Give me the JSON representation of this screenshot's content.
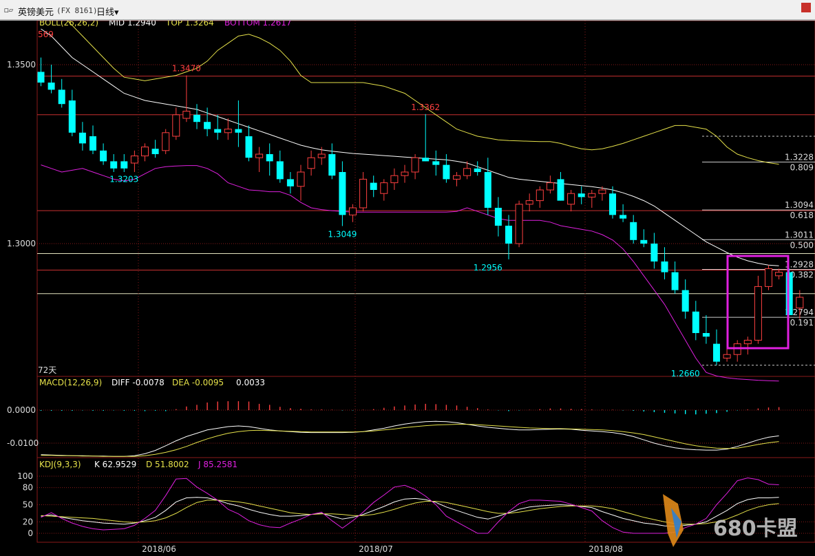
{
  "window": {
    "icon": "chart-window-icon",
    "title": "英镑美元",
    "code": "(FX 8161)",
    "period": "日线",
    "period_caret": "▾"
  },
  "colors": {
    "up": "#ff4040",
    "down": "#00ffff",
    "boll_mid": "#ffffff",
    "boll_top": "#e6e24a",
    "boll_bottom": "#e020e0",
    "diff": "#ffffff",
    "dea": "#e6e24a",
    "k": "#ffffff",
    "d": "#e6e24a",
    "j": "#e020e0",
    "grid_red": "#8b1a1a",
    "highlight": "#e020e0"
  },
  "main_panel": {
    "indicator": "BOLL(26,26,2)",
    "mid": "MID 1.2940",
    "top": "TOP 1.3264",
    "bottom": "BOTTOM 1.2617",
    "left_partial": "569",
    "bars_label": "72天",
    "price_axis": [
      {
        "label": "1.3500",
        "value": 1.35
      },
      {
        "label": "1.3000",
        "value": 1.3
      }
    ],
    "annotations": [
      {
        "text": "1.3470",
        "price": 1.347,
        "color": "#ff4040",
        "bar": 14,
        "pos": "above"
      },
      {
        "text": "1.3362",
        "price": 1.3362,
        "color": "#ff4040",
        "bar": 37,
        "pos": "above"
      },
      {
        "text": "1.3203",
        "price": 1.3203,
        "color": "#00ffff",
        "bar": 8,
        "pos": "below"
      },
      {
        "text": "1.3049",
        "price": 1.3049,
        "color": "#00ffff",
        "bar": 29,
        "pos": "below"
      },
      {
        "text": "1.2956",
        "price": 1.2956,
        "color": "#00ffff",
        "bar": 43,
        "pos": "below"
      },
      {
        "text": "1.2660",
        "price": 1.266,
        "color": "#00ffff",
        "bar": 62,
        "pos": "below"
      }
    ],
    "fib_levels": [
      {
        "price_label": "1.3228",
        "ratio_label": "0.809",
        "price": 1.3228
      },
      {
        "price_label": "1.3094",
        "ratio_label": "0.618",
        "price": 1.3094
      },
      {
        "price_label": "1.3011",
        "ratio_label": "0.500",
        "price": 1.3011
      },
      {
        "price_label": "1.2928",
        "ratio_label": "0.382",
        "price": 1.2928
      },
      {
        "price_label": "1.2794",
        "ratio_label": "0.191",
        "price": 1.2794
      }
    ]
  },
  "macd_panel": {
    "indicator": "MACD(12,26,9)",
    "diff": "DIFF -0.0078",
    "dea": "DEA -0.0095",
    "macd": "0.0033",
    "axis": [
      {
        "label": "0.0000",
        "value": 0.0
      },
      {
        "label": "-0.0100",
        "value": -0.01
      }
    ]
  },
  "kdj_panel": {
    "indicator": "KDJ(9,3,3)",
    "k": "K 62.9529",
    "d": "D 51.8002",
    "j": "J 85.2581",
    "axis": [
      "100",
      "80",
      "50",
      "20",
      "0"
    ]
  },
  "date_axis": [
    "2018/06",
    "2018/07",
    "2018/08"
  ],
  "watermark": {
    "text": "680卡盟",
    "icon": "sail-logo-icon"
  },
  "chart_data": {
    "type": "candlestick",
    "candles": [
      [
        1.348,
        1.352,
        1.344,
        1.345
      ],
      [
        1.345,
        1.35,
        1.342,
        1.343
      ],
      [
        1.343,
        1.346,
        1.338,
        1.339
      ],
      [
        1.34,
        1.343,
        1.33,
        1.331
      ],
      [
        1.331,
        1.334,
        1.326,
        1.328
      ],
      [
        1.33,
        1.333,
        1.325,
        1.326
      ],
      [
        1.326,
        1.328,
        1.322,
        1.323
      ],
      [
        1.323,
        1.325,
        1.32,
        1.321
      ],
      [
        1.323,
        1.325,
        1.32,
        1.321
      ],
      [
        1.3225,
        1.326,
        1.32,
        1.3245
      ],
      [
        1.3245,
        1.328,
        1.323,
        1.327
      ],
      [
        1.3265,
        1.329,
        1.324,
        1.325
      ],
      [
        1.326,
        1.332,
        1.325,
        1.331
      ],
      [
        1.33,
        1.338,
        1.329,
        1.336
      ],
      [
        1.335,
        1.347,
        1.334,
        1.337
      ],
      [
        1.336,
        1.339,
        1.332,
        1.334
      ],
      [
        1.334,
        1.338,
        1.33,
        1.332
      ],
      [
        1.332,
        1.336,
        1.329,
        1.331
      ],
      [
        1.331,
        1.335,
        1.329,
        1.332
      ],
      [
        1.332,
        1.34,
        1.327,
        1.331
      ],
      [
        1.33,
        1.333,
        1.323,
        1.324
      ],
      [
        1.324,
        1.327,
        1.32,
        1.325
      ],
      [
        1.325,
        1.328,
        1.319,
        1.323
      ],
      [
        1.323,
        1.326,
        1.317,
        1.318
      ],
      [
        1.318,
        1.32,
        1.314,
        1.316
      ],
      [
        1.316,
        1.322,
        1.312,
        1.32
      ],
      [
        1.321,
        1.326,
        1.319,
        1.324
      ],
      [
        1.324,
        1.327,
        1.322,
        1.325
      ],
      [
        1.325,
        1.328,
        1.318,
        1.319
      ],
      [
        1.32,
        1.323,
        1.3049,
        1.308
      ],
      [
        1.308,
        1.311,
        1.306,
        1.31
      ],
      [
        1.31,
        1.32,
        1.309,
        1.318
      ],
      [
        1.317,
        1.319,
        1.313,
        1.315
      ],
      [
        1.314,
        1.318,
        1.312,
        1.317
      ],
      [
        1.317,
        1.321,
        1.315,
        1.319
      ],
      [
        1.319,
        1.322,
        1.317,
        1.32
      ],
      [
        1.32,
        1.325,
        1.318,
        1.324
      ],
      [
        1.324,
        1.3362,
        1.323,
        1.323
      ],
      [
        1.323,
        1.326,
        1.319,
        1.322
      ],
      [
        1.322,
        1.325,
        1.317,
        1.318
      ],
      [
        1.318,
        1.32,
        1.316,
        1.319
      ],
      [
        1.319,
        1.323,
        1.318,
        1.321
      ],
      [
        1.321,
        1.323,
        1.319,
        1.32
      ],
      [
        1.32,
        1.324,
        1.308,
        1.31
      ],
      [
        1.31,
        1.313,
        1.302,
        1.305
      ],
      [
        1.305,
        1.308,
        1.2956,
        1.3
      ],
      [
        1.3,
        1.312,
        1.299,
        1.311
      ],
      [
        1.311,
        1.314,
        1.309,
        1.312
      ],
      [
        1.312,
        1.316,
        1.31,
        1.315
      ],
      [
        1.315,
        1.319,
        1.314,
        1.317
      ],
      [
        1.318,
        1.32,
        1.312,
        1.312
      ],
      [
        1.311,
        1.315,
        1.309,
        1.314
      ],
      [
        1.314,
        1.316,
        1.311,
        1.313
      ],
      [
        1.313,
        1.315,
        1.31,
        1.314
      ],
      [
        1.314,
        1.316,
        1.312,
        1.315
      ],
      [
        1.314,
        1.316,
        1.307,
        1.308
      ],
      [
        1.308,
        1.311,
        1.306,
        1.307
      ],
      [
        1.306,
        1.308,
        1.3,
        1.301
      ],
      [
        1.301,
        1.304,
        1.299,
        1.3
      ],
      [
        1.3,
        1.303,
        1.293,
        1.295
      ],
      [
        1.295,
        1.299,
        1.29,
        1.292
      ],
      [
        1.292,
        1.295,
        1.286,
        1.287
      ],
      [
        1.287,
        1.29,
        1.279,
        1.281
      ],
      [
        1.281,
        1.284,
        1.273,
        1.275
      ],
      [
        1.275,
        1.28,
        1.272,
        1.274
      ],
      [
        1.272,
        1.276,
        1.266,
        1.267
      ],
      [
        1.268,
        1.271,
        1.267,
        1.269
      ],
      [
        1.269,
        1.273,
        1.267,
        1.272
      ],
      [
        1.272,
        1.274,
        1.269,
        1.273
      ],
      [
        1.273,
        1.291,
        1.272,
        1.288
      ],
      [
        1.288,
        1.294,
        1.287,
        1.293
      ],
      [
        1.291,
        1.293,
        1.29,
        1.292
      ],
      [
        1.292,
        1.293,
        1.28,
        1.28
      ],
      [
        1.282,
        1.287,
        1.279,
        1.285
      ]
    ],
    "boll_mid": [
      1.36,
      1.358,
      1.355,
      1.352,
      1.35,
      1.348,
      1.346,
      1.344,
      1.342,
      1.341,
      1.34,
      1.3395,
      1.339,
      1.3385,
      1.338,
      1.3375,
      1.3365,
      1.3355,
      1.3345,
      1.3335,
      1.3325,
      1.3315,
      1.3305,
      1.3295,
      1.3285,
      1.3275,
      1.3268,
      1.3262,
      1.3258,
      1.3255,
      1.3252,
      1.325,
      1.3248,
      1.3246,
      1.3244,
      1.3242,
      1.324,
      1.3238,
      1.3236,
      1.3234,
      1.323,
      1.3225,
      1.3215,
      1.3205,
      1.3195,
      1.3185,
      1.318,
      1.3177,
      1.3174,
      1.3171,
      1.3168,
      1.3165,
      1.3162,
      1.3159,
      1.3155,
      1.315,
      1.3142,
      1.3132,
      1.312,
      1.3105,
      1.3085,
      1.3065,
      1.3045,
      1.3025,
      1.3005,
      1.299,
      1.2975,
      1.2962,
      1.2952,
      1.2945,
      1.294,
      1.2938
    ],
    "boll_top": [
      1.37,
      1.367,
      1.364,
      1.361,
      1.358,
      1.355,
      1.352,
      1.349,
      1.3465,
      1.346,
      1.3455,
      1.346,
      1.3465,
      1.347,
      1.348,
      1.349,
      1.351,
      1.354,
      1.356,
      1.358,
      1.3585,
      1.3575,
      1.356,
      1.354,
      1.351,
      1.347,
      1.345,
      1.345,
      1.345,
      1.345,
      1.345,
      1.345,
      1.3445,
      1.344,
      1.343,
      1.342,
      1.34,
      1.338,
      1.336,
      1.334,
      1.332,
      1.331,
      1.33,
      1.3295,
      1.329,
      1.3288,
      1.3287,
      1.3286,
      1.3285,
      1.3285,
      1.328,
      1.3272,
      1.3265,
      1.3262,
      1.3265,
      1.3272,
      1.328,
      1.329,
      1.33,
      1.331,
      1.332,
      1.333,
      1.333,
      1.3325,
      1.332,
      1.33,
      1.327,
      1.325,
      1.324,
      1.3232,
      1.3226,
      1.3222
    ],
    "boll_bottom": [
      1.322,
      1.321,
      1.32,
      1.3205,
      1.321,
      1.32,
      1.319,
      1.318,
      1.3175,
      1.318,
      1.3195,
      1.321,
      1.3215,
      1.3217,
      1.3218,
      1.3218,
      1.321,
      1.3195,
      1.317,
      1.316,
      1.315,
      1.3148,
      1.3145,
      1.3145,
      1.3135,
      1.3115,
      1.31,
      1.3095,
      1.3092,
      1.309,
      1.3088,
      1.3088,
      1.3088,
      1.3088,
      1.3088,
      1.3088,
      1.3088,
      1.3088,
      1.3088,
      1.3088,
      1.309,
      1.31,
      1.309,
      1.308,
      1.307,
      1.3065,
      1.3065,
      1.3065,
      1.3065,
      1.306,
      1.305,
      1.3045,
      1.304,
      1.3035,
      1.3025,
      1.301,
      1.2985,
      1.295,
      1.291,
      1.287,
      1.283,
      1.278,
      1.273,
      1.268,
      1.264,
      1.263,
      1.2625,
      1.2622,
      1.262,
      1.2618,
      1.2617,
      1.2616
    ],
    "macd_hist": [
      -0.0002,
      -0.0002,
      -0.0002,
      -0.0002,
      -0.0001,
      -0.0002,
      -0.0002,
      -0.0001,
      -0.0002,
      -0.0002,
      -0.0003,
      -0.0002,
      -0.0003,
      0.0003,
      0.0011,
      0.0016,
      0.0023,
      0.0026,
      0.0027,
      0.0027,
      0.0026,
      0.0019,
      0.0016,
      0.001,
      0.0006,
      0.0004,
      0.0002,
      0.0002,
      0.0001,
      -0.0001,
      -0.0001,
      0.0001,
      0.0003,
      0.0007,
      0.0011,
      0.0014,
      0.0017,
      0.0019,
      0.0018,
      0.0016,
      0.0014,
      0.001,
      0.0006,
      0.0002,
      -0.0001,
      -0.0003,
      -0.0001,
      0.0001,
      0.0003,
      0.0005,
      0.0005,
      0.0004,
      0.0003,
      0.0002,
      0.0001,
      0.0001,
      -0.0001,
      -0.0002,
      -0.0004,
      -0.0006,
      -0.0008,
      -0.001,
      -0.0012,
      -0.0013,
      -0.0011,
      -0.0009,
      -0.0005,
      -0.0001,
      0.0002,
      0.0005,
      0.0008,
      0.0009
    ],
    "macd_diff": [
      -0.0135,
      -0.0136,
      -0.0137,
      -0.0138,
      -0.0138,
      -0.0139,
      -0.0139,
      -0.014,
      -0.014,
      -0.0138,
      -0.0132,
      -0.0122,
      -0.0108,
      -0.0093,
      -0.008,
      -0.007,
      -0.006,
      -0.0055,
      -0.005,
      -0.0048,
      -0.005,
      -0.0055,
      -0.006,
      -0.0063,
      -0.0065,
      -0.0067,
      -0.0068,
      -0.0068,
      -0.0068,
      -0.0068,
      -0.0067,
      -0.0065,
      -0.006,
      -0.0055,
      -0.0048,
      -0.0042,
      -0.0038,
      -0.0035,
      -0.0034,
      -0.0035,
      -0.0038,
      -0.0043,
      -0.0048,
      -0.0052,
      -0.0055,
      -0.0058,
      -0.006,
      -0.006,
      -0.0059,
      -0.0058,
      -0.0057,
      -0.0058,
      -0.0061,
      -0.0063,
      -0.0065,
      -0.0068,
      -0.0073,
      -0.008,
      -0.009,
      -0.01,
      -0.0108,
      -0.0114,
      -0.0118,
      -0.012,
      -0.0121,
      -0.0121,
      -0.0118,
      -0.011,
      -0.01,
      -0.009,
      -0.0082,
      -0.0078
    ],
    "macd_dea": [
      -0.0137,
      -0.0137,
      -0.0138,
      -0.0138,
      -0.0139,
      -0.0139,
      -0.014,
      -0.014,
      -0.014,
      -0.014,
      -0.0138,
      -0.0134,
      -0.0128,
      -0.012,
      -0.011,
      -0.0098,
      -0.0087,
      -0.0078,
      -0.007,
      -0.0065,
      -0.0062,
      -0.0061,
      -0.0062,
      -0.0063,
      -0.0064,
      -0.0065,
      -0.0066,
      -0.0066,
      -0.0066,
      -0.0066,
      -0.0066,
      -0.0065,
      -0.0063,
      -0.006,
      -0.0057,
      -0.0053,
      -0.005,
      -0.0047,
      -0.0045,
      -0.0044,
      -0.0043,
      -0.0043,
      -0.0044,
      -0.0046,
      -0.0048,
      -0.005,
      -0.0052,
      -0.0054,
      -0.0055,
      -0.0056,
      -0.0056,
      -0.0057,
      -0.0058,
      -0.0059,
      -0.006,
      -0.0062,
      -0.0065,
      -0.0069,
      -0.0074,
      -0.0081,
      -0.0088,
      -0.0095,
      -0.0102,
      -0.0108,
      -0.0112,
      -0.0115,
      -0.0116,
      -0.0115,
      -0.011,
      -0.0104,
      -0.0099,
      -0.0095
    ],
    "kdj_k": [
      30,
      32,
      28,
      25,
      22,
      20,
      18,
      17,
      16,
      18,
      22,
      28,
      40,
      55,
      62,
      63,
      62,
      58,
      52,
      48,
      42,
      37,
      33,
      30,
      30,
      31,
      33,
      35,
      30,
      25,
      28,
      33,
      40,
      47,
      55,
      60,
      61,
      59,
      54,
      46,
      40,
      34,
      28,
      25,
      30,
      36,
      42,
      46,
      48,
      49,
      50,
      49,
      47,
      45,
      38,
      32,
      26,
      22,
      18,
      16,
      13,
      12,
      14,
      16,
      20,
      30,
      40,
      52,
      59,
      62,
      62,
      63
    ],
    "kdj_d": [
      31,
      30,
      29,
      28,
      27,
      26,
      24,
      22,
      20,
      19,
      20,
      22,
      27,
      35,
      45,
      54,
      58,
      58,
      57,
      55,
      52,
      48,
      44,
      40,
      36,
      34,
      33,
      34,
      34,
      33,
      31,
      31,
      33,
      37,
      42,
      48,
      53,
      56,
      56,
      54,
      50,
      46,
      42,
      38,
      35,
      35,
      37,
      40,
      43,
      45,
      47,
      48,
      48,
      48,
      46,
      43,
      38,
      33,
      28,
      24,
      20,
      17,
      16,
      16,
      17,
      20,
      25,
      32,
      40,
      46,
      50,
      52
    ],
    "kdj_j": [
      28,
      36,
      26,
      18,
      12,
      8,
      6,
      7,
      8,
      14,
      26,
      40,
      66,
      95,
      96,
      81,
      70,
      58,
      42,
      34,
      22,
      15,
      11,
      10,
      18,
      25,
      33,
      37,
      22,
      9,
      22,
      37,
      54,
      67,
      81,
      84,
      77,
      65,
      50,
      30,
      20,
      10,
      0,
      0,
      20,
      38,
      52,
      58,
      58,
      57,
      56,
      51,
      45,
      39,
      22,
      10,
      2,
      0,
      0,
      0,
      0,
      2,
      10,
      16,
      26,
      50,
      70,
      92,
      97,
      94,
      86,
      85
    ]
  }
}
